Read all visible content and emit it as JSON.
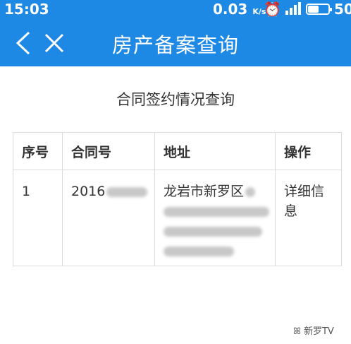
{
  "status_bar": {
    "time": "15:03",
    "net_speed": "0.03",
    "net_unit": "K/s",
    "battery_level": "50",
    "battery_fill_pct": 50
  },
  "nav": {
    "title": "房产备案查询",
    "back_icon": "chevron-left-icon",
    "close_icon": "close-icon"
  },
  "page": {
    "subtitle": "合同签约情况查询"
  },
  "table": {
    "headers": [
      "序号",
      "合同号",
      "地址",
      "操作"
    ],
    "rows": [
      {
        "index": "1",
        "contract_no": "2016",
        "address": "龙岩市新罗区",
        "action": "详细信息"
      }
    ]
  },
  "watermark": {
    "text": "新罗TV"
  }
}
